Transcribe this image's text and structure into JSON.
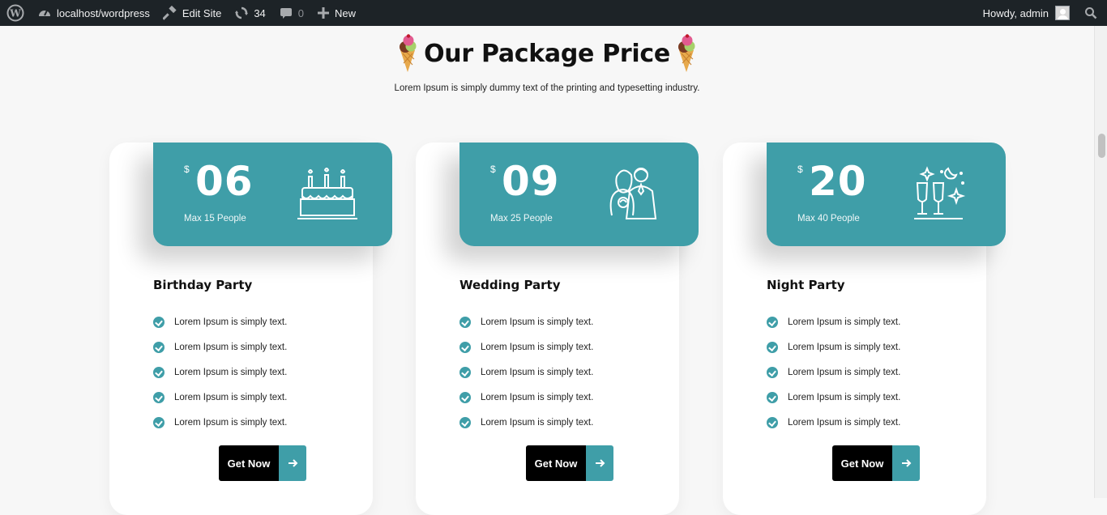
{
  "adminbar": {
    "site": "localhost/wordpress",
    "edit_site": "Edit Site",
    "updates_count": "34",
    "comments_count": "0",
    "new_label": "New",
    "howdy": "Howdy, admin"
  },
  "section": {
    "title": "Our Package Price",
    "subtitle": "Lorem Ipsum is simply dummy text of the printing and typesetting industry."
  },
  "packages": [
    {
      "currency": "$",
      "price": "06",
      "people": "Max 15 People",
      "icon": "birthday-cake-icon",
      "title": "Birthday Party",
      "features": [
        "Lorem Ipsum is simply text.",
        "Lorem Ipsum is simply text.",
        "Lorem Ipsum is simply text.",
        "Lorem Ipsum is simply text.",
        "Lorem Ipsum is simply text."
      ],
      "button": "Get Now"
    },
    {
      "currency": "$",
      "price": "09",
      "people": "Max 25 People",
      "icon": "wedding-couple-icon",
      "title": "Wedding Party",
      "features": [
        "Lorem Ipsum is simply text.",
        "Lorem Ipsum is simply text.",
        "Lorem Ipsum is simply text.",
        "Lorem Ipsum is simply text.",
        "Lorem Ipsum is simply text."
      ],
      "button": "Get Now"
    },
    {
      "currency": "$",
      "price": "20",
      "people": "Max 40 People",
      "icon": "champagne-glasses-icon",
      "title": "Night Party",
      "features": [
        "Lorem Ipsum is simply text.",
        "Lorem Ipsum is simply text.",
        "Lorem Ipsum is simply text.",
        "Lorem Ipsum is simply text.",
        "Lorem Ipsum is simply text."
      ],
      "button": "Get Now"
    }
  ],
  "colors": {
    "accent": "#3f9ea8",
    "adminbar": "#1d2327",
    "button": "#000000"
  }
}
